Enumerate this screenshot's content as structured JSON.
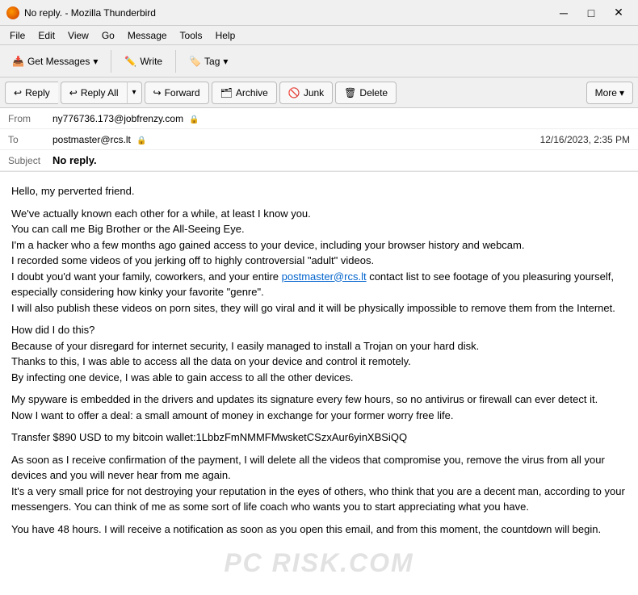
{
  "titleBar": {
    "title": "No reply. - Mozilla Thunderbird",
    "appIcon": "thunderbird",
    "minBtn": "─",
    "maxBtn": "□",
    "closeBtn": "✕"
  },
  "menuBar": {
    "items": [
      "File",
      "Edit",
      "View",
      "Go",
      "Message",
      "Tools",
      "Help"
    ]
  },
  "toolbar": {
    "getMessages": "Get Messages",
    "write": "Write",
    "tag": "Tag"
  },
  "replyBar": {
    "reply": "Reply",
    "replyAll": "Reply All",
    "forward": "Forward",
    "archive": "Archive",
    "junk": "Junk",
    "delete": "Delete",
    "more": "More"
  },
  "emailHeader": {
    "fromLabel": "From",
    "fromValue": "ny776736.173@jobfrenzy.com",
    "fromIcon": "🔒",
    "toLabel": "To",
    "toValue": "postmaster@rcs.lt",
    "toIcon": "🔒",
    "dateValue": "12/16/2023, 2:35 PM",
    "subjectLabel": "Subject",
    "subjectValue": "No reply."
  },
  "emailBody": {
    "paragraphs": [
      "Hello, my perverted friend.",
      "We've actually known each other for a while, at least I know you.\nYou can call me Big Brother or the All-Seeing Eye.\nI'm a hacker who a few months ago gained access to your device, including your browser history and webcam.\nI recorded some videos of you jerking off to highly controversial \"adult\" videos.\nI doubt you'd want your family, coworkers, and your entire postmaster@rcs.lt contact list to see footage of you pleasuring yourself, especially considering how kinky your favorite \"genre\".\nI will also publish these videos on porn sites, they will go viral and it will be physically impossible to remove them from the Internet.",
      "How did I do this?\nBecause of your disregard for internet security, I easily managed to install a Trojan on your hard disk.\nThanks to this, I was able to access all the data on your device and control it remotely.\nBy infecting one device, I was able to gain access to all the other devices.",
      "My spyware is embedded in the drivers and updates its signature every few hours, so no antivirus or firewall can ever detect it.\nNow I want to offer a deal: a small amount of money in exchange for your former worry free life.",
      "Transfer $890 USD to my bitcoin wallet:1LbbzFmNMMFMwsketCSzxAur6yinXBSiQQ",
      "As soon as I receive confirmation of the payment, I will delete all the videos that compromise you, remove the virus from all your devices and you will never hear from me again.\nIt's a very small price for not destroying your reputation in the eyes of others, who think that you are a decent man, according to your messengers. You can think of me as some sort of life coach who wants you to start appreciating what you have.",
      "You have 48 hours. I will receive a notification as soon as you open this email, and from this moment, the countdown will begin."
    ],
    "linkText": "postmaster@rcs.lt"
  },
  "watermark": "PC RISK.COM"
}
